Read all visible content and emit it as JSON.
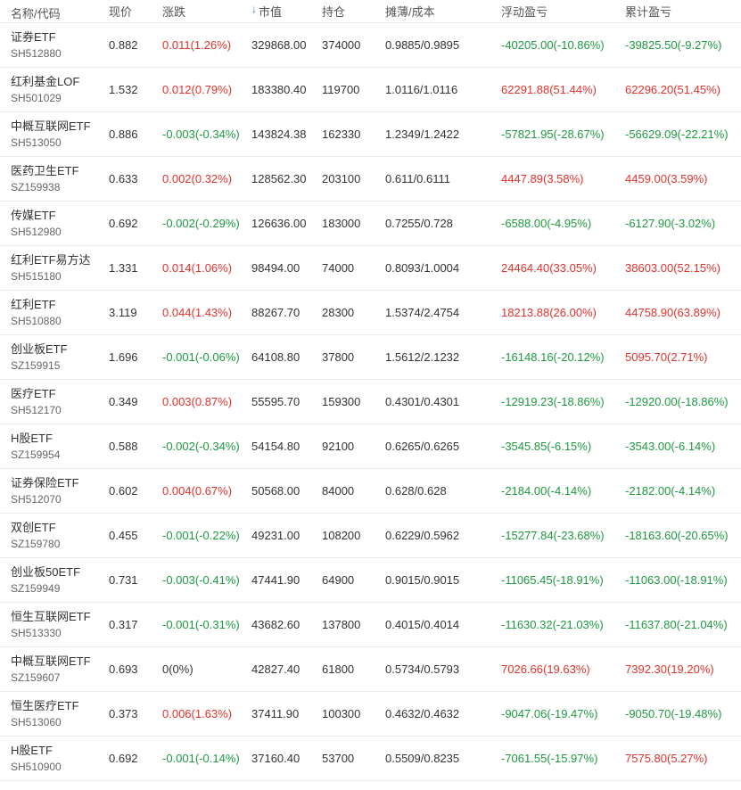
{
  "headers": {
    "name_code": "名称/代码",
    "price": "现价",
    "change": "涨跌",
    "sort_arrow": "↓",
    "market_value": "市值",
    "position": "持仓",
    "cost": "摊薄/成本",
    "floating_pl": "浮动盈亏",
    "cumulative_pl": "累计盈亏"
  },
  "sort_icon": "arrow-down-icon",
  "colors": {
    "up": "#e3322b",
    "down": "#1d9a3f",
    "sort_accent": "#2f7ad8"
  },
  "rows": [
    {
      "name": "证券ETF",
      "code": "SH512880",
      "price": "0.882",
      "change": "0.011(1.26%)",
      "market_value": "329868.00",
      "position": "374000",
      "cost": "0.9885/0.9895",
      "floating_pl": "-40205.00(-10.86%)",
      "cumulative_pl": "-39825.50(-9.27%)"
    },
    {
      "name": "红利基金LOF",
      "code": "SH501029",
      "price": "1.532",
      "change": "0.012(0.79%)",
      "market_value": "183380.40",
      "position": "119700",
      "cost": "1.0116/1.0116",
      "floating_pl": "62291.88(51.44%)",
      "cumulative_pl": "62296.20(51.45%)"
    },
    {
      "name": "中概互联网ETF",
      "code": "SH513050",
      "price": "0.886",
      "change": "-0.003(-0.34%)",
      "market_value": "143824.38",
      "position": "162330",
      "cost": "1.2349/1.2422",
      "floating_pl": "-57821.95(-28.67%)",
      "cumulative_pl": "-56629.09(-22.21%)"
    },
    {
      "name": "医药卫生ETF",
      "code": "SZ159938",
      "price": "0.633",
      "change": "0.002(0.32%)",
      "market_value": "128562.30",
      "position": "203100",
      "cost": "0.611/0.6111",
      "floating_pl": "4447.89(3.58%)",
      "cumulative_pl": "4459.00(3.59%)"
    },
    {
      "name": "传媒ETF",
      "code": "SH512980",
      "price": "0.692",
      "change": "-0.002(-0.29%)",
      "market_value": "126636.00",
      "position": "183000",
      "cost": "0.7255/0.728",
      "floating_pl": "-6588.00(-4.95%)",
      "cumulative_pl": "-6127.90(-3.02%)"
    },
    {
      "name": "红利ETF易方达",
      "code": "SH515180",
      "price": "1.331",
      "change": "0.014(1.06%)",
      "market_value": "98494.00",
      "position": "74000",
      "cost": "0.8093/1.0004",
      "floating_pl": "24464.40(33.05%)",
      "cumulative_pl": "38603.00(52.15%)"
    },
    {
      "name": "红利ETF",
      "code": "SH510880",
      "price": "3.119",
      "change": "0.044(1.43%)",
      "market_value": "88267.70",
      "position": "28300",
      "cost": "1.5374/2.4754",
      "floating_pl": "18213.88(26.00%)",
      "cumulative_pl": "44758.90(63.89%)"
    },
    {
      "name": "创业板ETF",
      "code": "SZ159915",
      "price": "1.696",
      "change": "-0.001(-0.06%)",
      "market_value": "64108.80",
      "position": "37800",
      "cost": "1.5612/2.1232",
      "floating_pl": "-16148.16(-20.12%)",
      "cumulative_pl": "5095.70(2.71%)"
    },
    {
      "name": "医疗ETF",
      "code": "SH512170",
      "price": "0.349",
      "change": "0.003(0.87%)",
      "market_value": "55595.70",
      "position": "159300",
      "cost": "0.4301/0.4301",
      "floating_pl": "-12919.23(-18.86%)",
      "cumulative_pl": "-12920.00(-18.86%)"
    },
    {
      "name": "H股ETF",
      "code": "SZ159954",
      "price": "0.588",
      "change": "-0.002(-0.34%)",
      "market_value": "54154.80",
      "position": "92100",
      "cost": "0.6265/0.6265",
      "floating_pl": "-3545.85(-6.15%)",
      "cumulative_pl": "-3543.00(-6.14%)"
    },
    {
      "name": "证券保险ETF",
      "code": "SH512070",
      "price": "0.602",
      "change": "0.004(0.67%)",
      "market_value": "50568.00",
      "position": "84000",
      "cost": "0.628/0.628",
      "floating_pl": "-2184.00(-4.14%)",
      "cumulative_pl": "-2182.00(-4.14%)"
    },
    {
      "name": "双创ETF",
      "code": "SZ159780",
      "price": "0.455",
      "change": "-0.001(-0.22%)",
      "market_value": "49231.00",
      "position": "108200",
      "cost": "0.6229/0.5962",
      "floating_pl": "-15277.84(-23.68%)",
      "cumulative_pl": "-18163.60(-20.65%)"
    },
    {
      "name": "创业板50ETF",
      "code": "SZ159949",
      "price": "0.731",
      "change": "-0.003(-0.41%)",
      "market_value": "47441.90",
      "position": "64900",
      "cost": "0.9015/0.9015",
      "floating_pl": "-11065.45(-18.91%)",
      "cumulative_pl": "-11063.00(-18.91%)"
    },
    {
      "name": "恒生互联网ETF",
      "code": "SH513330",
      "price": "0.317",
      "change": "-0.001(-0.31%)",
      "market_value": "43682.60",
      "position": "137800",
      "cost": "0.4015/0.4014",
      "floating_pl": "-11630.32(-21.03%)",
      "cumulative_pl": "-11637.80(-21.04%)"
    },
    {
      "name": "中概互联网ETF",
      "code": "SZ159607",
      "price": "0.693",
      "change": "0(0%)",
      "market_value": "42827.40",
      "position": "61800",
      "cost": "0.5734/0.5793",
      "floating_pl": "7026.66(19.63%)",
      "cumulative_pl": "7392.30(19.20%)"
    },
    {
      "name": "恒生医疗ETF",
      "code": "SH513060",
      "price": "0.373",
      "change": "0.006(1.63%)",
      "market_value": "37411.90",
      "position": "100300",
      "cost": "0.4632/0.4632",
      "floating_pl": "-9047.06(-19.47%)",
      "cumulative_pl": "-9050.70(-19.48%)"
    },
    {
      "name": "H股ETF",
      "code": "SH510900",
      "price": "0.692",
      "change": "-0.001(-0.14%)",
      "market_value": "37160.40",
      "position": "53700",
      "cost": "0.5509/0.8235",
      "floating_pl": "-7061.55(-15.97%)",
      "cumulative_pl": "7575.80(5.27%)"
    }
  ]
}
